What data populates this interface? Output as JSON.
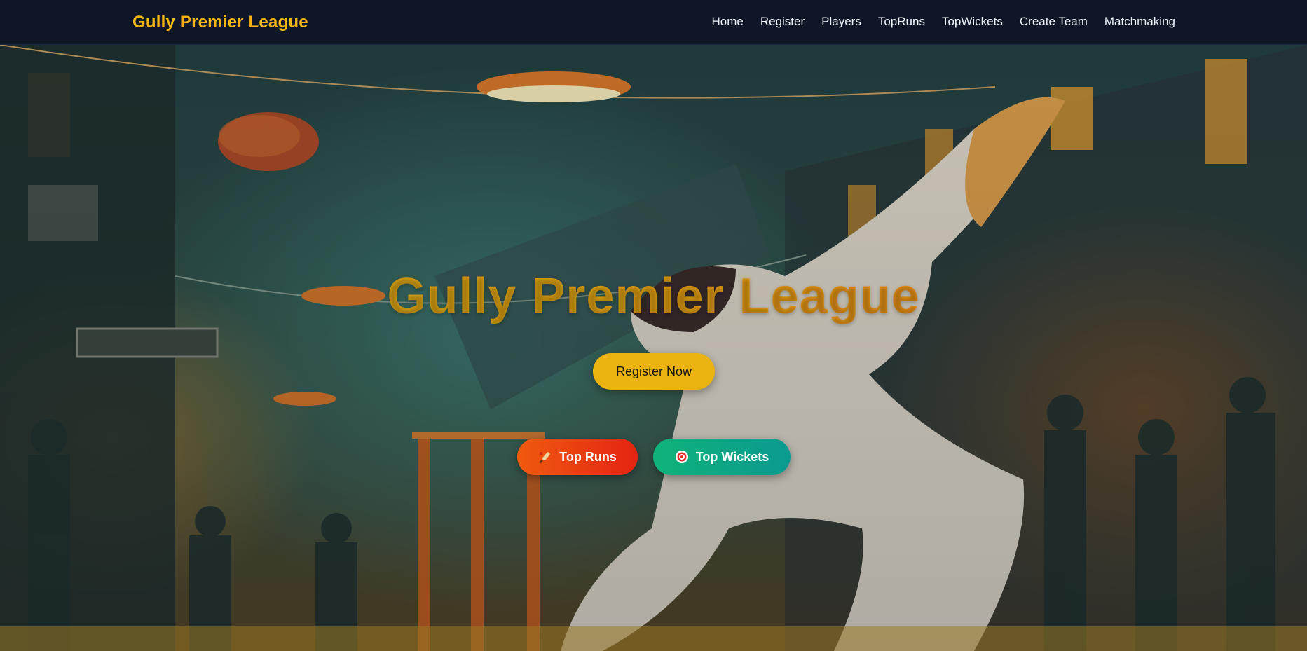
{
  "navbar": {
    "brand": "Gully Premier League",
    "links": [
      "Home",
      "Register",
      "Players",
      "TopRuns",
      "TopWickets",
      "Create Team",
      "Matchmaking"
    ]
  },
  "hero": {
    "background_image": "night street cricket illustration: batsman in white kit swinging bat, cricket ball in air, wickets, lamps, spectators silhouettes",
    "title": "Gully Premier League",
    "register_button": "Register Now",
    "top_runs_button": "Top Runs",
    "top_runs_icon": "cricket-bat-icon",
    "top_wickets_button": "Top Wickets",
    "top_wickets_icon": "target-icon"
  },
  "colors": {
    "navbar_bg": "#0e1628",
    "brand": "#f4b412",
    "register_btn": "#eab30f",
    "top_runs_btn": "#f05a10",
    "top_wickets_btn": "#10b37a"
  }
}
